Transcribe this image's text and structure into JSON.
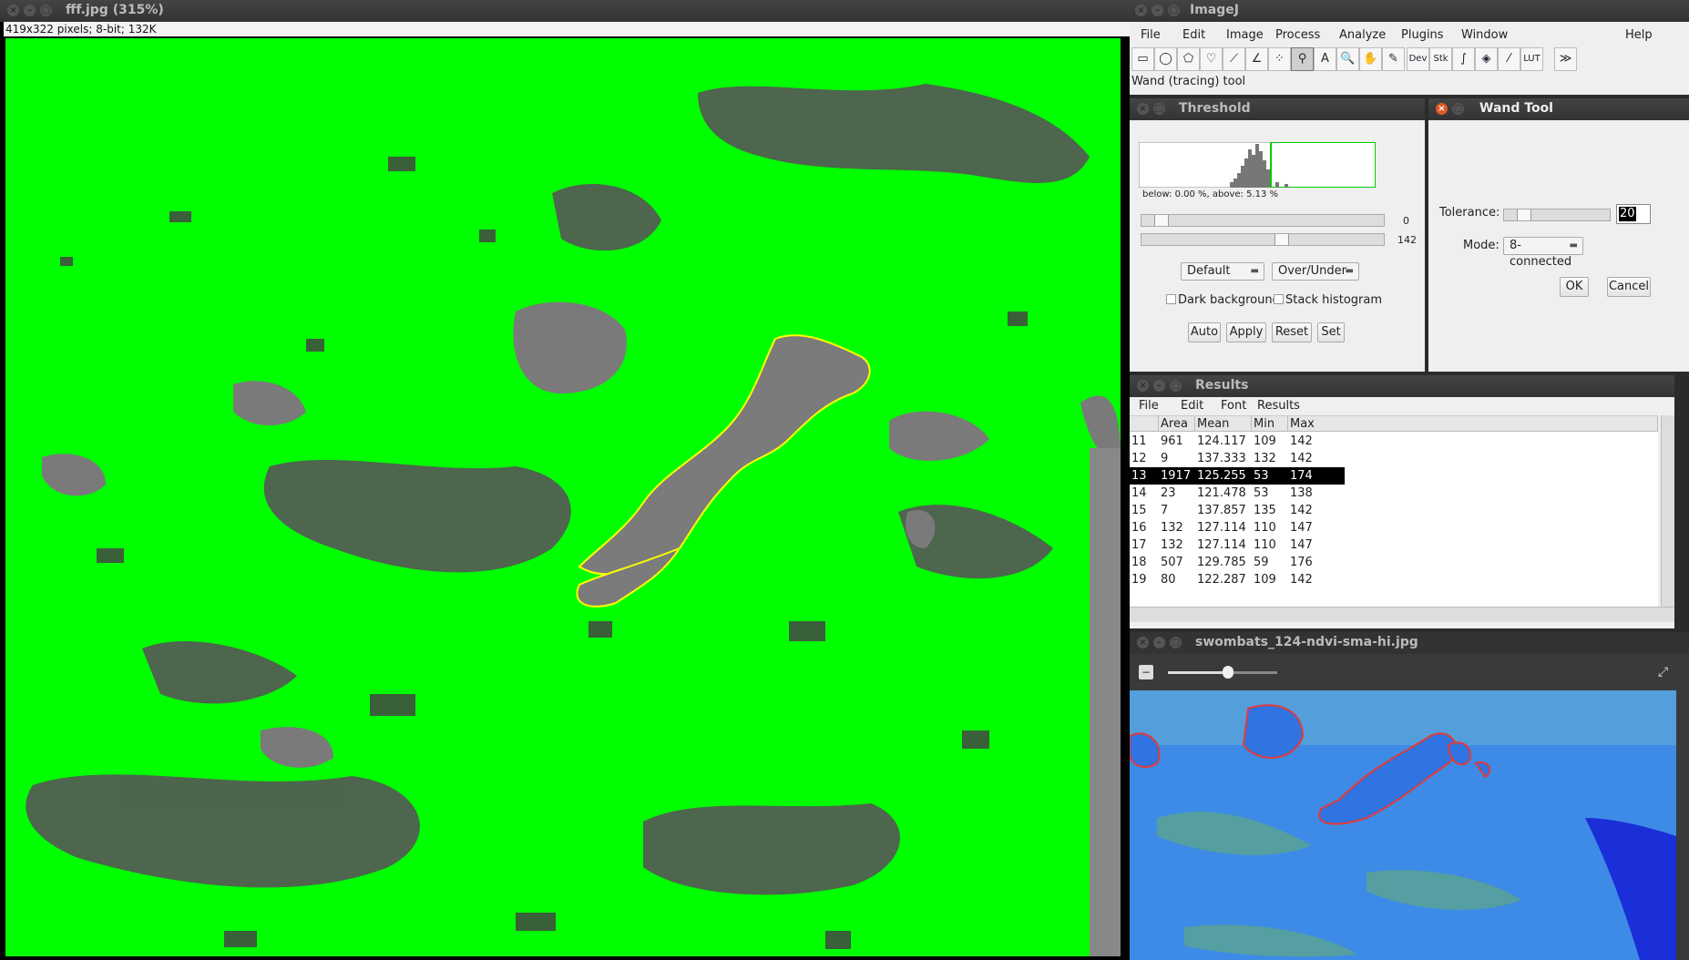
{
  "image_window": {
    "title": "fff.jpg (315%)",
    "info": "419x322 pixels; 8-bit; 132K"
  },
  "imagej": {
    "title": "ImageJ",
    "menu": [
      "File",
      "Edit",
      "Image",
      "Process",
      "Analyze",
      "Plugins",
      "Window",
      "Help"
    ],
    "tools": [
      {
        "name": "rectangle-tool-icon",
        "glyph": "▭"
      },
      {
        "name": "oval-tool-icon",
        "glyph": "◯"
      },
      {
        "name": "polygon-tool-icon",
        "glyph": "⬠"
      },
      {
        "name": "freehand-tool-icon",
        "glyph": "♡"
      },
      {
        "name": "line-tool-icon",
        "glyph": "⟋"
      },
      {
        "name": "angle-tool-icon",
        "glyph": "∠"
      },
      {
        "name": "point-tool-icon",
        "glyph": "⁘"
      },
      {
        "name": "wand-tool-icon",
        "glyph": "⚲"
      },
      {
        "name": "text-tool-icon",
        "glyph": "A"
      },
      {
        "name": "magnifier-tool-icon",
        "glyph": "🔍"
      },
      {
        "name": "hand-tool-icon",
        "glyph": "✋"
      },
      {
        "name": "color-picker-tool-icon",
        "glyph": "✎"
      },
      {
        "name": "dev-tool-icon",
        "glyph": "Dev"
      },
      {
        "name": "stk-tool-icon",
        "glyph": "Stk"
      },
      {
        "name": "brush-tool-icon",
        "glyph": "∫"
      },
      {
        "name": "flood-fill-tool-icon",
        "glyph": "◈"
      },
      {
        "name": "pencil-tool-icon",
        "glyph": "⁄"
      },
      {
        "name": "lut-tool-icon",
        "glyph": "LUT"
      },
      {
        "name": "more-tools-icon",
        "glyph": "≫"
      }
    ],
    "status": "Wand (tracing) tool"
  },
  "threshold": {
    "title": "Threshold",
    "stats": "below: 0.00 %,  above: 5.13 %",
    "min_value": "0",
    "max_value": "142",
    "method": "Default",
    "display": "Over/Under",
    "dark_background_label": "Dark background",
    "stack_histogram_label": "Stack histogram",
    "buttons": {
      "auto": "Auto",
      "apply": "Apply",
      "reset": "Reset",
      "set": "Set"
    }
  },
  "wand": {
    "title": "Wand Tool",
    "tolerance_label": "Tolerance:",
    "tolerance_value": "20",
    "mode_label": "Mode:",
    "mode_value": "8-connected",
    "ok": "OK",
    "cancel": "Cancel"
  },
  "results": {
    "title": "Results",
    "menu": [
      "File",
      "Edit",
      "Font",
      "Results"
    ],
    "columns": [
      "",
      "Area",
      "Mean",
      "Min",
      "Max"
    ],
    "rows": [
      [
        "11",
        "961",
        "124.117",
        "109",
        "142"
      ],
      [
        "12",
        "9",
        "137.333",
        "132",
        "142"
      ],
      [
        "13",
        "1917",
        "125.255",
        "53",
        "174"
      ],
      [
        "14",
        "23",
        "121.478",
        "53",
        "138"
      ],
      [
        "15",
        "7",
        "137.857",
        "135",
        "142"
      ],
      [
        "16",
        "132",
        "127.114",
        "110",
        "147"
      ],
      [
        "17",
        "132",
        "127.114",
        "110",
        "147"
      ],
      [
        "18",
        "507",
        "129.785",
        "59",
        "176"
      ],
      [
        "19",
        "80",
        "122.287",
        "109",
        "142"
      ]
    ],
    "selected_index": 2
  },
  "preview": {
    "title": "swombats_124-ndvi-sma-hi.jpg",
    "zoom_level": 0.55
  },
  "colors": {
    "threshold_green": "#00ff00",
    "roi_yellow": "#ffff00",
    "roi_red": "#e23a3a",
    "ndvi_blue": "#3d8be6"
  }
}
